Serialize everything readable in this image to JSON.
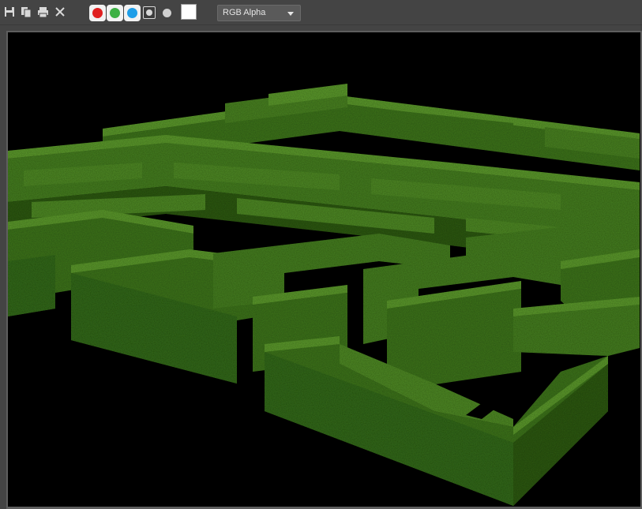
{
  "toolbar": {
    "buttons": [
      {
        "name": "save-icon"
      },
      {
        "name": "clone-icon"
      },
      {
        "name": "print-icon"
      },
      {
        "name": "close-icon"
      }
    ],
    "channels": [
      {
        "name": "red-channel-toggle",
        "color": "#e02020"
      },
      {
        "name": "green-channel-toggle",
        "color": "#3cb043"
      },
      {
        "name": "blue-channel-toggle",
        "color": "#1e9ee8"
      }
    ],
    "background_swatch_color": "#ffffff",
    "channel_select": {
      "value": "RGB Alpha"
    }
  },
  "viewport": {
    "background": "#000000",
    "hedge_colors": {
      "top": "#4f8a25",
      "side": "#3e751c",
      "dark": "#2e5a14"
    }
  }
}
